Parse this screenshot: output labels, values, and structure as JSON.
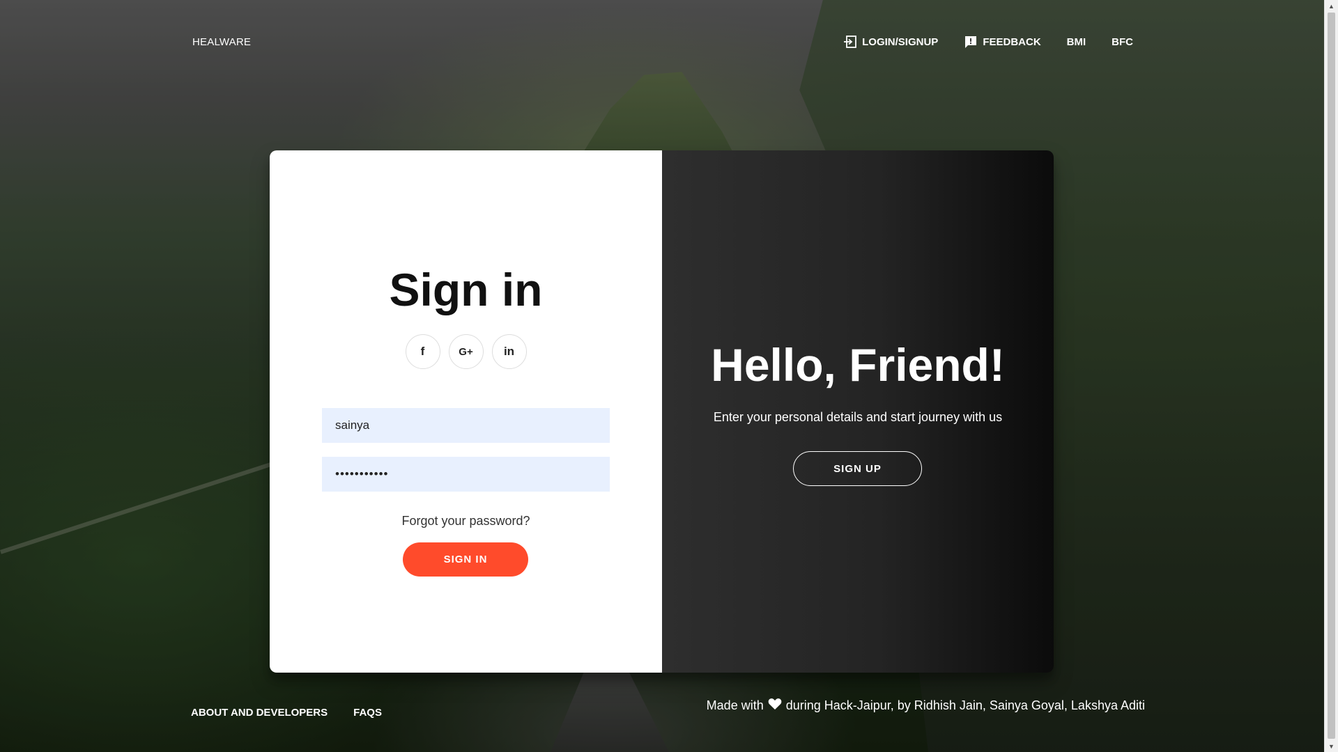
{
  "brand": {
    "name": "HEALWARE"
  },
  "nav": {
    "items": [
      {
        "label": "LOGIN/SIGNUP",
        "icon": "login-icon"
      },
      {
        "label": "FEEDBACK",
        "icon": "feedback-icon"
      },
      {
        "label": "BMI"
      },
      {
        "label": "BFC"
      }
    ]
  },
  "signin": {
    "title": "Sign in",
    "socials": [
      {
        "icon": "facebook-icon",
        "glyph": "f"
      },
      {
        "icon": "google-plus-icon",
        "glyph": "G+"
      },
      {
        "icon": "linkedin-icon",
        "glyph": "in"
      }
    ],
    "username_value": "sainya",
    "password_value": "•••••••••••",
    "forgot": "Forgot your password?",
    "button": "SIGN IN"
  },
  "overlay_panel": {
    "title": "Hello, Friend!",
    "subtitle": "Enter your personal details and start journey with us",
    "button": "SIGN UP"
  },
  "footer": {
    "links": [
      "ABOUT AND DEVELOPERS",
      "FAQS"
    ],
    "credits_before": "Made with",
    "credits_after": "during Hack-Jaipur, by Ridhish Jain, Sainya Goyal, Lakshya Aditi"
  },
  "colors": {
    "accent": "#ff4b2b",
    "input_bg": "#e8f0fe",
    "panel_dark": "#242424"
  }
}
